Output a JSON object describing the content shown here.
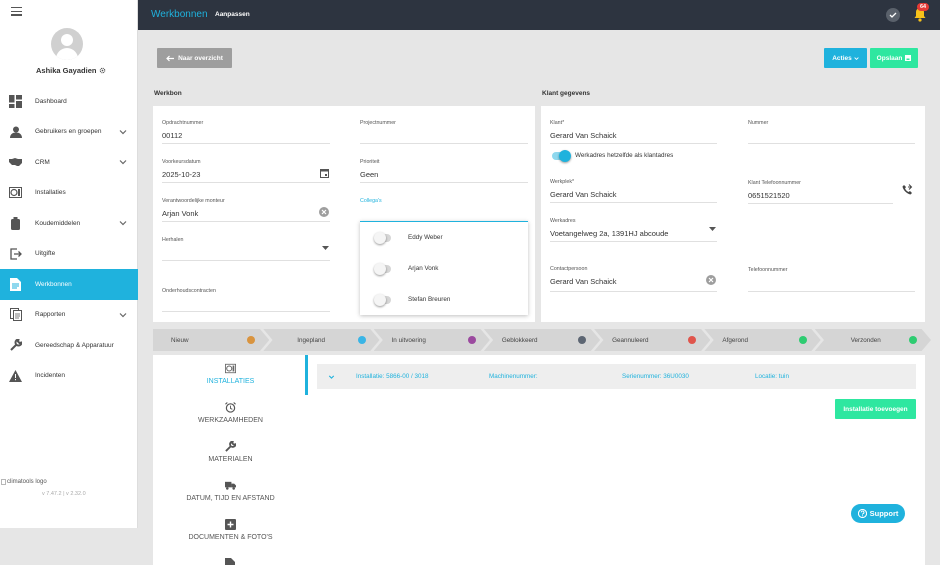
{
  "sidebar": {
    "user_name": "Ashika Gayadien",
    "items": [
      {
        "label": "Dashboard",
        "icon": "dashboard-icon"
      },
      {
        "label": "Gebruikers en groepen",
        "icon": "user-icon",
        "has_submenu": true
      },
      {
        "label": "CRM",
        "icon": "handshake-icon",
        "has_submenu": true
      },
      {
        "label": "Installaties",
        "icon": "installation-icon"
      },
      {
        "label": "Koudemiddelen",
        "icon": "cylinder-icon",
        "has_submenu": true
      },
      {
        "label": "Uitgifte",
        "icon": "exit-icon"
      },
      {
        "label": "Werkbonnen",
        "icon": "document-icon",
        "active": true
      },
      {
        "label": "Rapporten",
        "icon": "report-icon",
        "has_submenu": true
      },
      {
        "label": "Gereedschap & Apparatuur",
        "icon": "wrench-icon"
      },
      {
        "label": "Incidenten",
        "icon": "warning-icon"
      }
    ],
    "logo_alt": "climatools logo",
    "version": "v 7.47.2 | v 2.32.0"
  },
  "header": {
    "title": "Werkbonnen",
    "subtitle": "Aanpassen",
    "notification_count": "64"
  },
  "toolbar": {
    "back_label": "Naar overzicht",
    "acties_label": "Acties",
    "opslaan_label": "Opslaan"
  },
  "werkbon": {
    "section_title": "Werkbon",
    "opdrachtnummer": {
      "label": "Opdrachtnummer",
      "value": "00112"
    },
    "projectnummer": {
      "label": "Projectnummer",
      "value": ""
    },
    "voorkeursdatum": {
      "label": "Voorkeursdatum",
      "value": "2025-10-23"
    },
    "prioriteit": {
      "label": "Prioriteit",
      "value": "Geen"
    },
    "monteur": {
      "label": "Verantwoordelijke monteur",
      "value": "Arjan Vonk"
    },
    "collegas": {
      "label": "Collega's",
      "options": [
        "Eddy Weber",
        "Arjan Vonk",
        "Stefan Breuren"
      ]
    },
    "herhalen": {
      "label": "Herhalen",
      "value": ""
    },
    "onderhoudscontracten": {
      "label": "Onderhoudscontracten",
      "value": ""
    }
  },
  "klant": {
    "section_title": "Klant gegevens",
    "klant": {
      "label": "Klant*",
      "value": "Gerard Van Schaick"
    },
    "nummer": {
      "label": "Nummer",
      "value": ""
    },
    "werkadres_toggle": "Werkadres hetzelfde als klantadres",
    "werkplek": {
      "label": "Werkplek*",
      "value": "Gerard Van Schaick"
    },
    "klant_telefoon": {
      "label": "Klant Telefoonnummer",
      "value": "0651521520"
    },
    "werkadres": {
      "label": "Werkadres",
      "value": "Voetangelweg 2a, 1391HJ abcoude"
    },
    "contactpersoon": {
      "label": "Contactpersoon",
      "value": "Gerard Van Schaick"
    },
    "telefoonnummer": {
      "label": "Telefoonnummer",
      "value": ""
    }
  },
  "status": [
    {
      "label": "Nieuw",
      "color": "#d9943f"
    },
    {
      "label": "Ingepland",
      "color": "#3ab5e6"
    },
    {
      "label": "In uitvoering",
      "color": "#9b4a9f"
    },
    {
      "label": "Geblokkeerd",
      "color": "#5d6673"
    },
    {
      "label": "Geannuleerd",
      "color": "#e0554c"
    },
    {
      "label": "Afgerond",
      "color": "#2ecc71"
    },
    {
      "label": "Verzonden",
      "color": "#2ecc71"
    }
  ],
  "tabs": [
    {
      "label": "INSTALLATIES",
      "icon": "installation-icon",
      "active": true
    },
    {
      "label": "WERKZAAMHEDEN",
      "icon": "alarm-clock-icon"
    },
    {
      "label": "MATERIALEN",
      "icon": "wrench-icon"
    },
    {
      "label": "DATUM, TIJD EN AFSTAND",
      "icon": "truck-icon"
    },
    {
      "label": "DOCUMENTEN & FOTO'S",
      "icon": "plus-box-icon"
    }
  ],
  "installation_row": {
    "installatie": "Installatie: 5866-00 / 3018",
    "machinenummer": "Machinenummer:",
    "serienummer": "Serienummer: 36U0030",
    "locatie": "Locatie: tuin"
  },
  "add_installation_label": "Installatie toevoegen",
  "support_label": "Support"
}
